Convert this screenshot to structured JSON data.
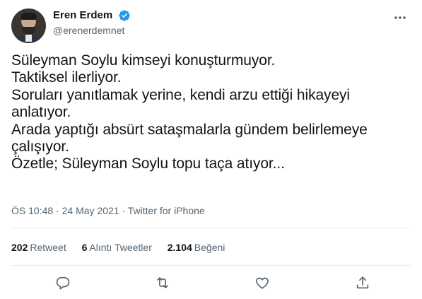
{
  "author": {
    "display_name": "Eren Erdem",
    "handle": "@erenerdemnet",
    "verified": true,
    "avatar_icon": "profile-photo"
  },
  "tweet": {
    "lines": [
      "Süleyman Soylu kimseyi konuşturmuyor.",
      "Taktiksel ilerliyor.",
      "Soruları yanıtlamak yerine, kendi arzu ettiği hikayeyi",
      "anlatıyor.",
      "Arada yaptığı absürt sataşmalarla gündem belirlemeye",
      "çalışıyor.",
      "Özetle; Süleyman Soylu topu taça atıyor..."
    ]
  },
  "meta": {
    "time": "ÖS 10:48",
    "dot1": "·",
    "date": "24 May 2021",
    "dot2": "·",
    "source": "Twitter for iPhone"
  },
  "stats": {
    "retweets_count": "202",
    "retweets_label": "Retweet",
    "quotes_count": "6",
    "quotes_label": "Alıntı Tweetler",
    "likes_count": "2.104",
    "likes_label": "Beğeni"
  },
  "colors": {
    "text": "#0f1419",
    "secondary": "#536471",
    "verified_blue": "#1d9bf0",
    "divider": "#e6ecf0"
  }
}
